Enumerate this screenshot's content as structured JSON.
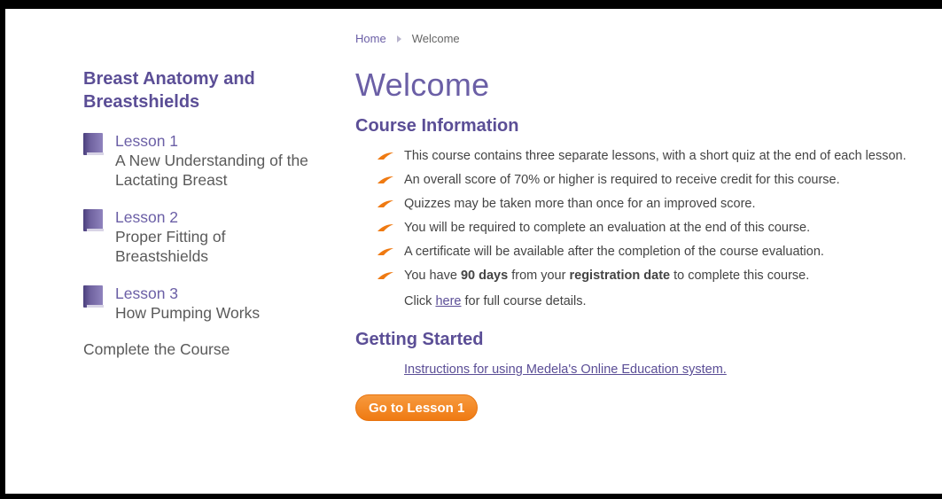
{
  "sidebar": {
    "title_line1": "Breast Anatomy and",
    "title_line2": "Breastshields",
    "lessons": [
      {
        "label": "Lesson 1",
        "desc_line1": "A New Understanding of the",
        "desc_line2": "Lactating Breast"
      },
      {
        "label": "Lesson 2",
        "desc_line1": "Proper Fitting of",
        "desc_line2": "Breastshields"
      },
      {
        "label": "Lesson 3",
        "desc_line1": "How Pumping Works",
        "desc_line2": ""
      }
    ],
    "complete_label": "Complete the Course"
  },
  "breadcrumb": {
    "home": "Home",
    "current": "Welcome"
  },
  "page_title": "Welcome",
  "course_info": {
    "heading": "Course Information",
    "items": [
      "This course contains three separate lessons, with a short quiz at the end of each lesson.",
      "An overall score of 70% or higher is required to receive credit for this course.",
      "Quizzes may be taken more than once for an improved score.",
      "You will be required to complete an evaluation at the end of this course.",
      "A certificate will be available after the completion of the course evaluation."
    ],
    "last_item": {
      "before": "You have ",
      "bold1": "90 days",
      "middle": " from your ",
      "bold2": "registration date",
      "after": " to complete this course."
    },
    "click_before": "Click ",
    "click_link": "here",
    "click_after": " for full course details."
  },
  "getting_started": {
    "heading": "Getting Started",
    "instructions_link": "Instructions for using Medela's Online Education system."
  },
  "go_button_label": "Go to Lesson 1",
  "colors": {
    "accent_purple": "#5b4e96",
    "accent_orange": "#ef7a12"
  }
}
